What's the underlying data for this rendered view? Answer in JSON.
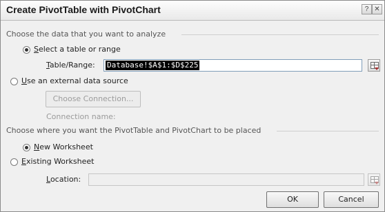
{
  "dialog": {
    "title": "Create PivotTable with PivotChart",
    "help_glyph": "?",
    "close_glyph": "✕"
  },
  "data_section": {
    "heading": "Choose the data that you want to analyze",
    "option_table": {
      "prefix": "",
      "mnemonic": "S",
      "rest": "elect a table or range",
      "selected": true
    },
    "range_label": {
      "mnemonic": "T",
      "rest": "able/Range:"
    },
    "range_value": "Database!$A$1:$D$225",
    "option_external": {
      "mnemonic": "U",
      "rest": "se an external data source",
      "selected": false
    },
    "choose_connection_label": "Choose Connection...",
    "connection_name_label": "Connection name:"
  },
  "placement_section": {
    "heading": "Choose where you want the PivotTable and PivotChart to be placed",
    "option_new": {
      "mnemonic": "N",
      "rest": "ew Worksheet",
      "selected": true
    },
    "option_existing": {
      "mnemonic": "E",
      "rest": "xisting Worksheet",
      "selected": false
    },
    "location_label": {
      "mnemonic": "L",
      "rest": "ocation:"
    },
    "location_value": ""
  },
  "buttons": {
    "ok": "OK",
    "cancel": "Cancel"
  },
  "icons": {
    "range_picker": "range-picker-icon",
    "location_picker": "location-picker-icon"
  }
}
